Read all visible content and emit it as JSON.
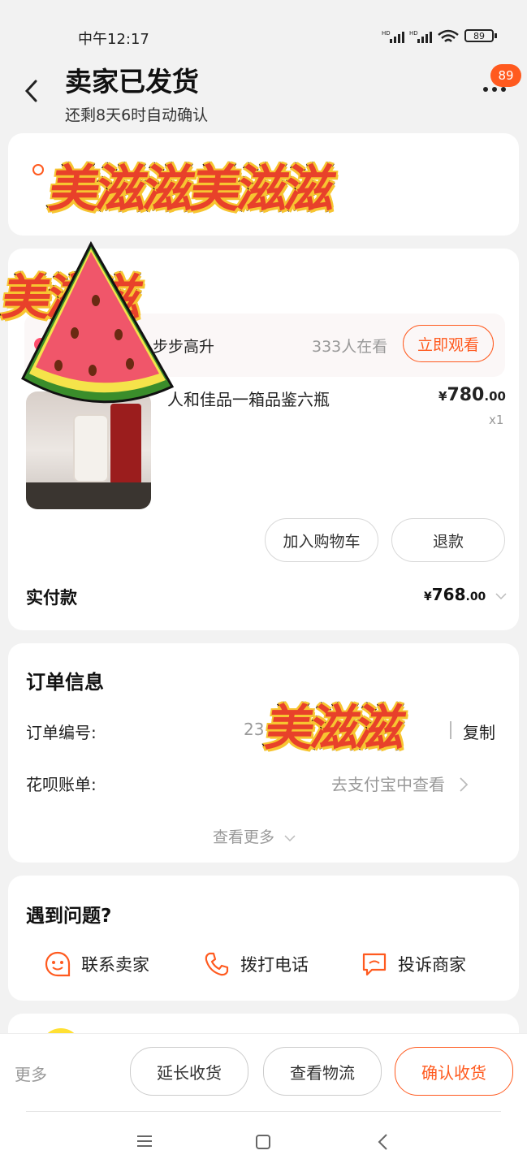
{
  "status_bar": {
    "time": "中午12:17",
    "net1": "HD",
    "net2": "HD",
    "battery": "89"
  },
  "header": {
    "title": "卖家已发货",
    "subtitle": "还剩8天6时自动确认",
    "badge_count": "89"
  },
  "stickers": {
    "text1": "美滋滋美滋滋",
    "text2": "美滋滋",
    "text3": "美滋滋"
  },
  "live": {
    "name": "步步高升",
    "viewers": "333人在看",
    "watch_button": "立即观看"
  },
  "product": {
    "title": "人和佳品一箱品鉴六瓶",
    "price_symbol": "¥",
    "price_int": "780",
    "price_dec": ".00",
    "quantity": "x1",
    "btn_cart": "加入购物车",
    "btn_refund": "退款"
  },
  "payment": {
    "label": "实付款",
    "symbol": "¥",
    "amount_int": "768",
    "amount_dec": ".00"
  },
  "order_info": {
    "title": "订单信息",
    "order_no_label": "订单编号:",
    "order_no_value": "23",
    "copy": "复制",
    "huabei_label": "花呗账单:",
    "huabei_value": "去支付宝中查看",
    "more": "查看更多"
  },
  "help": {
    "title": "遇到问题?",
    "contact": "联系卖家",
    "call": "拨打电话",
    "complain": "投诉商家"
  },
  "bottom_bar": {
    "more": "更多",
    "extend": "延长收货",
    "logistics": "查看物流",
    "confirm": "确认收货"
  },
  "colors": {
    "accent": "#ff5000",
    "bg": "#f2f2f2",
    "card": "#ffffff"
  }
}
